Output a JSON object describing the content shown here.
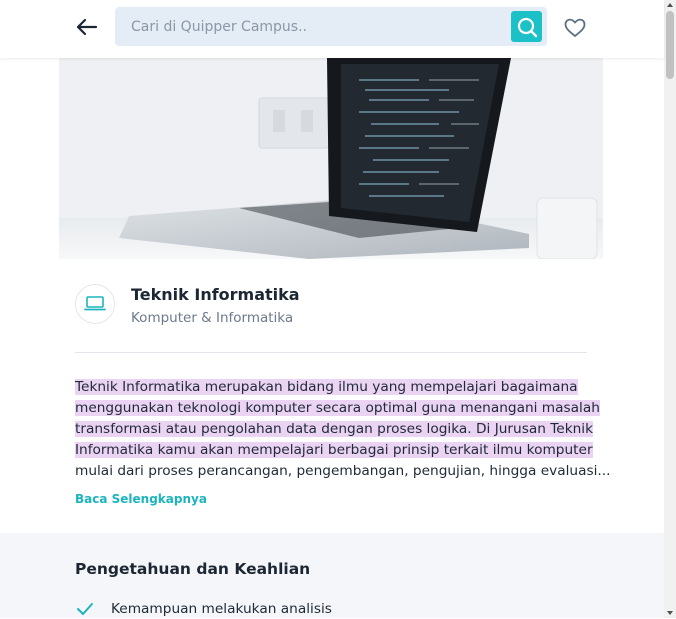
{
  "header": {
    "search_placeholder": "Cari di Quipper Campus..",
    "back_icon": "arrow-left-icon",
    "search_icon": "search-icon",
    "favorite_icon": "heart-icon"
  },
  "hero": {
    "image": "laptop-photo"
  },
  "major": {
    "icon": "laptop-icon",
    "title": "Teknik Informatika",
    "category": "Komputer & Informatika"
  },
  "description": {
    "lines": [
      "Teknik Informatika merupakan bidang ilmu yang mempelajari bagaimana",
      "menggunakan teknologi komputer secara optimal guna menangani masalah",
      "transformasi atau pengolahan data dengan proses logika. Di Jurusan Teknik",
      "Informatika kamu akan mempelajari berbagai prinsip terkait ilmu komputer",
      "mulai dari proses perancangan, pengembangan, pengujian, hingga evaluasi..."
    ],
    "read_more": "Baca Selengkapnya"
  },
  "skills": {
    "title": "Pengetahuan dan Keahlian",
    "items": [
      "Kemampuan melakukan analisis"
    ]
  },
  "colors": {
    "accent": "#1cc0c7",
    "highlight": "#ead3f3",
    "search_bg": "#e4ecf5"
  }
}
